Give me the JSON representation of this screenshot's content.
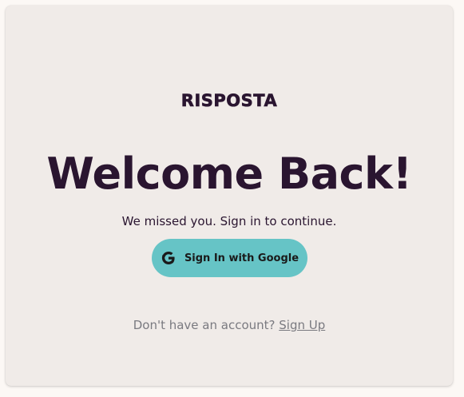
{
  "brand": {
    "name": "RISPOSTA"
  },
  "hero": {
    "title": "Welcome Back!",
    "subtitle": "We missed you. Sign in to continue."
  },
  "auth": {
    "google_button_label": "Sign In with Google",
    "google_icon": "google-g-icon"
  },
  "footer": {
    "prompt": "Don't have an account? ",
    "signup_label": "Sign Up"
  },
  "colors": {
    "accent": "#66c4c6",
    "text_dark": "#2a1530",
    "card_bg": "#f0ebe8",
    "muted": "#7a7a80"
  }
}
